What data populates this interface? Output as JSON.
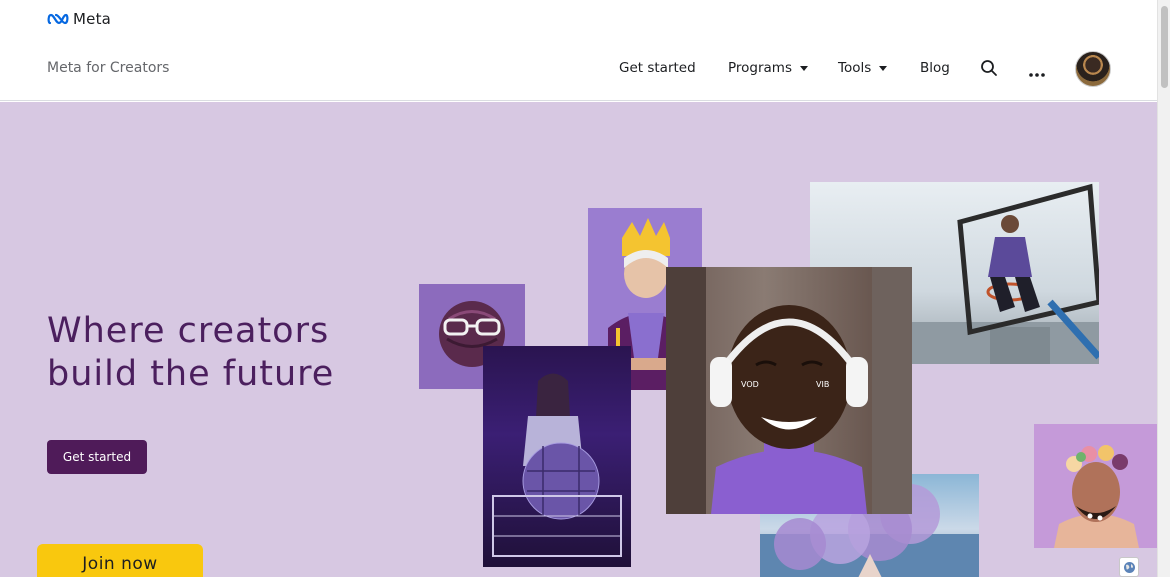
{
  "header": {
    "logo_text": "Meta",
    "brand": "Meta for Creators",
    "nav": {
      "get_started": "Get started",
      "programs": "Programs",
      "tools": "Tools",
      "blog": "Blog"
    },
    "icons": {
      "search": "search-icon",
      "more": "more-icon",
      "avatar": "user-avatar"
    }
  },
  "hero": {
    "headline_line1": "Where creators",
    "headline_line2": "build the future",
    "cta_label": "Get started",
    "join_label": "Join now",
    "background": "#d7c8e2",
    "accent": "#4f1b59",
    "join_color": "#f9c80e"
  },
  "footer": {
    "language_icon": "globe-icon"
  }
}
